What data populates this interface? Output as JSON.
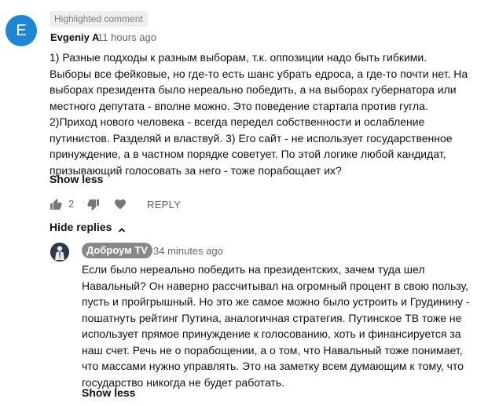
{
  "comment": {
    "badge": "Highlighted comment",
    "avatar_letter": "E",
    "author": "Evgeniy A",
    "time": "11 hours ago",
    "lines": [
      "1) Разные подходы к разным выборам, т.к. оппозиции надо быть гибкими.",
      "Выборы все фейковые, но где-то есть шанс убрать едроса, а где-то почти нет. На",
      "выборах президента было нереально победить, а на выборах губернатора или",
      "местного депутата - вполне можно. Это поведение стартапа против гугла.",
      "2)Приход нового человека - всегда передел собственности и ослабление",
      "путинистов. Разделяй и властвуй. 3) Его сайт - не использует государственное",
      "принуждение, а в частном порядке советует. По этой логике любой кандидат,",
      "призывающий голосовать за него - тоже порабощает их?"
    ],
    "show_less": "Show less",
    "like_count": "2",
    "reply_label": "REPLY",
    "avatar_color": "#1f86d6"
  },
  "replies_toggle": {
    "label": "Hide replies"
  },
  "reply": {
    "channel": "Доброум TV",
    "time": "34 minutes ago",
    "lines": [
      "Если было нереально победить на президентских, зачем туда шел",
      "Навальный? Он наверно рассчитывал на огромный процент в свою пользу,",
      "пусть и пройгрышный. Но это же самое можно было устроить и Грудинину -",
      "пошатнуть рейтинг Путина, аналогичная стратегия. Путинское ТВ тоже не",
      "использует прямое принуждение к голосованию, хоть и финансируется за",
      "наш счет. Речь не о порабощении, а о том, что Навальный тоже понимает,",
      "что массами нужно управлять. Это на заметку всем думающим к тому, что",
      "государство никогда не будет работать."
    ],
    "show_less": "Show less"
  },
  "icons": {
    "like": "thumbs-up-icon",
    "dislike": "thumbs-down-icon",
    "heart": "heart-icon",
    "chevron": "chevron-up-icon",
    "reply_avatar": "person-silhouette-icon"
  }
}
